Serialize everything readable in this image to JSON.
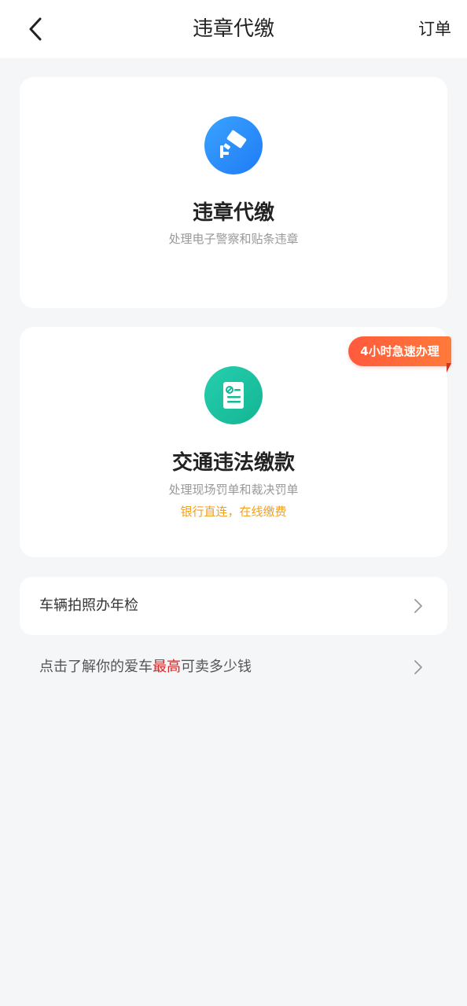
{
  "header": {
    "title": "违章代缴",
    "right_label": "订单",
    "back_icon": "chevron-left-icon"
  },
  "cards": [
    {
      "icon": "surveillance-camera-icon",
      "icon_color": "#2b8ff8",
      "title": "违章代缴",
      "subtitle": "处理电子警察和贴条违章"
    },
    {
      "icon": "document-ticket-icon",
      "icon_color": "#1ac2a0",
      "title": "交通违法缴款",
      "subtitle": "处理现场罚单和裁决罚单",
      "note": "银行直连，在线缴费",
      "badge": "4小时急速办理"
    }
  ],
  "inspection_row": {
    "label": "车辆拍照办年检",
    "arrow_icon": "chevron-right-icon"
  },
  "valuation_link": {
    "text_before": "点击了解你的爱车",
    "text_highlight": "最高",
    "text_after": "可卖多少钱",
    "highlight_color": "#e02020",
    "arrow_icon": "chevron-right-icon"
  },
  "colors": {
    "background": "#f5f6f8",
    "note_orange": "#f0a020",
    "badge_red": "#ff5a3c"
  }
}
